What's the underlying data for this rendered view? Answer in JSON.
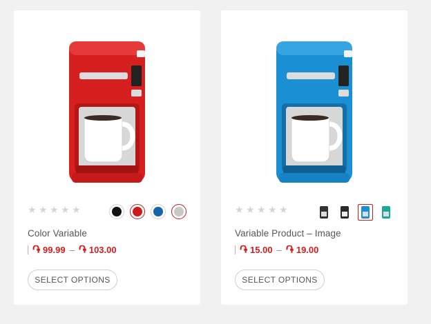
{
  "products": [
    {
      "title": "Color Variable",
      "image_alt": "red-coffee-maker",
      "accent": "#d61f1f",
      "rating_stars": 5,
      "currency_symbol": "֏",
      "price_min": "99.99",
      "price_max": "103.00",
      "price_sep": "–",
      "button_label": "SELECT OPTIONS",
      "swatches": [
        {
          "name": "black",
          "color": "#111111",
          "selected": false
        },
        {
          "name": "red",
          "color": "#cc1a1a",
          "selected": true
        },
        {
          "name": "blue",
          "color": "#1565a8",
          "selected": false
        },
        {
          "name": "silver",
          "color": "#c8c8c8",
          "selected": true
        }
      ]
    },
    {
      "title": "Variable Product – Image",
      "image_alt": "blue-coffee-maker",
      "accent": "#1b8fd4",
      "rating_stars": 5,
      "currency_symbol": "֏",
      "price_min": "15.00",
      "price_max": "19.00",
      "price_sep": "–",
      "button_label": "SELECT OPTIONS",
      "swatches": [
        {
          "name": "black-maker",
          "color": "#333333",
          "selected": false
        },
        {
          "name": "black-maker-2",
          "color": "#2a2a2a",
          "selected": false
        },
        {
          "name": "blue-maker",
          "color": "#1b8fd4",
          "selected": true
        },
        {
          "name": "teal-maker",
          "color": "#1aa89a",
          "selected": false
        }
      ]
    }
  ]
}
